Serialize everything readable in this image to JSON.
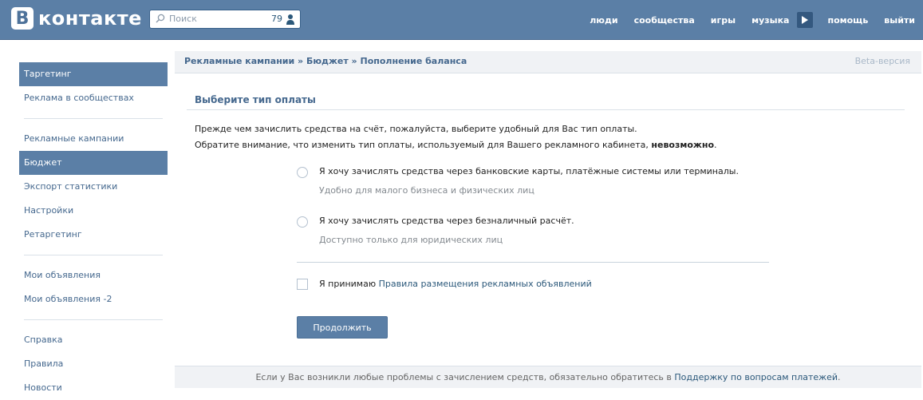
{
  "header": {
    "logo_letter": "В",
    "logo_text": "контакте",
    "search": {
      "placeholder": "Поиск",
      "count": "79"
    },
    "nav": [
      "люди",
      "сообщества",
      "игры",
      "музыка",
      "помощь",
      "выйти"
    ]
  },
  "sidebar": {
    "groups": [
      [
        "Таргетинг",
        "Реклама в сообществах"
      ],
      [
        "Рекламные кампании",
        "Бюджет",
        "Экспорт статистики",
        "Настройки",
        "Ретаргетинг"
      ],
      [
        "Мои объявления",
        "Мои объявления -2"
      ],
      [
        "Справка",
        "Правила",
        "Новости"
      ]
    ],
    "active": [
      "Таргетинг",
      "Бюджет"
    ]
  },
  "breadcrumb": "Рекламные кампании » Бюджет » Пополнение баланса",
  "beta": "Beta-версия",
  "panel_title": "Выберите тип оплаты",
  "intro": {
    "line1": "Прежде чем зачислить средства на счёт, пожалуйста, выберите удобный для Вас тип оплаты.",
    "line2_prefix": "Обратите внимание, что изменить тип оплаты, используемый для Вашего рекламного кабинета, ",
    "line2_bold": "невозможно",
    "line2_suffix": "."
  },
  "options": [
    {
      "label": "Я хочу зачислять средства через банковские карты, платёжные системы или терминалы.",
      "hint": "Удобно для малого бизнеса и физических лиц"
    },
    {
      "label": "Я хочу зачислять средства через безналичный расчёт.",
      "hint": "Доступно только для юридических лиц"
    }
  ],
  "agree": {
    "prefix": "Я принимаю ",
    "link": "Правила размещения рекламных объявлений"
  },
  "continue_label": "Продолжить",
  "footer": {
    "prefix": "Если у Вас возникли любые проблемы с зачислением средств, обязательно обратитесь в ",
    "link": "Поддержку по вопросам платежей",
    "suffix": "."
  },
  "colors": {
    "header": "#5b7fa6",
    "link": "#2b587a",
    "active": "#5b7fa6"
  }
}
